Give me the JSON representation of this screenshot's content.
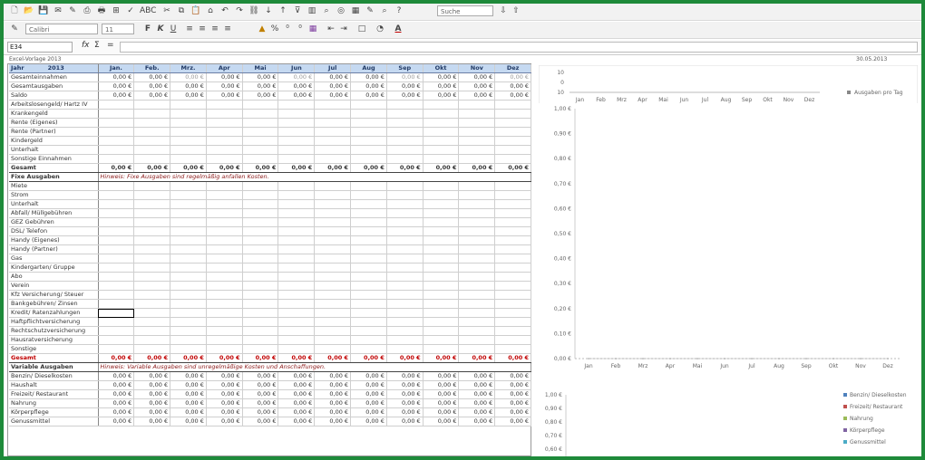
{
  "toolbar": {
    "search_placeholder": "Suche",
    "font_name": "Calibri",
    "font_size": "11",
    "bold_label": "F",
    "italic_label": "K",
    "underline_label": "U"
  },
  "formula_bar": {
    "cell_ref": "E34",
    "fx": "fx",
    "sum": "Σ",
    "eq": "="
  },
  "sheet": {
    "left_caption": "Excel-Vorlage 2013",
    "right_caption": "30.05.2013",
    "year_label": "Jahr",
    "year_value": "2013",
    "months": [
      "Jan.",
      "Feb.",
      "Mrz.",
      "Apr",
      "Mai",
      "Jun",
      "Jul",
      "Aug",
      "Sep",
      "Okt",
      "Nov",
      "Dez"
    ],
    "zero": "0,00 €",
    "summary_rows": [
      "Gesamteinnahmen",
      "Gesamtausgaben",
      "Saldo"
    ],
    "income_rows": [
      "Arbeitslosengeld/ Hartz IV",
      "Krankengeld",
      "Rente (Eigenes)",
      "Rente (Partner)",
      "Kindergeld",
      "Unterhalt",
      "Sonstige Einnahmen"
    ],
    "total_label": "Gesamt",
    "fixed_title": "Fixe Ausgaben",
    "fixed_hint": "Hinweis: Fixe Ausgaben sind regelmäßig anfallen Kosten.",
    "fixed_rows": [
      "Miete",
      "Strom",
      "Unterhalt",
      "Abfall/ Müllgebühren",
      "GEZ Gebühren",
      "DSL/ Telefon",
      "Handy (Eigenes)",
      "Handy (Partner)",
      "Gas",
      "Kindergarten/ Gruppe",
      "Abo",
      "Verein",
      "Kfz Versicherung/ Steuer",
      "Bankgebühren/ Zinsen",
      "Kredit/ Ratenzahlungen",
      "Haftpflichtversicherung",
      "Rechtschutzversicherung",
      "Hausratversicherung",
      "Sonstige"
    ],
    "var_title": "Variable Ausgaben",
    "var_hint": "Hinweis: Variable Ausgaben sind unregelmäßige Kosten und Anschaffungen.",
    "var_rows": [
      "Benzin/ Dieselkosten",
      "Haushalt",
      "Freizeit/ Restaurant",
      "Nahrung",
      "Körperpflege",
      "Genussmittel"
    ]
  },
  "chart_data": [
    {
      "type": "bar",
      "categories": [
        "Jan",
        "Feb",
        "Mrz",
        "Apr",
        "Mai",
        "Jun",
        "Jul",
        "Aug",
        "Sep",
        "Okt",
        "Nov",
        "Dez"
      ],
      "series": [
        {
          "name": "Ausgaben pro Tag",
          "values": [
            0,
            0,
            0,
            0,
            0,
            0,
            0,
            0,
            0,
            0,
            0,
            0
          ]
        }
      ],
      "y_ticks": [
        "10",
        "0",
        "10"
      ],
      "legend": "right"
    },
    {
      "type": "line",
      "categories": [
        "Jan",
        "Feb",
        "Mrz",
        "Apr",
        "Mai",
        "Jun",
        "Jul",
        "Aug",
        "Sep",
        "Okt",
        "Nov",
        "Dez"
      ],
      "series": [
        {
          "values": [
            0,
            0,
            0,
            0,
            0,
            0,
            0,
            0,
            0,
            0,
            0,
            0
          ]
        }
      ],
      "y_ticks": [
        "1,00 €",
        "0,90 €",
        "0,80 €",
        "0,70 €",
        "0,60 €",
        "0,50 €",
        "0,40 €",
        "0,30 €",
        "0,20 €",
        "0,10 €",
        "0,00 €"
      ],
      "ylim": [
        0,
        1
      ]
    },
    {
      "type": "bar",
      "y_ticks": [
        "1,00 €",
        "0,90 €",
        "0,80 €",
        "0,70 €",
        "0,60 €"
      ],
      "legend_entries": [
        "Benzin/ Dieselkosten",
        "Freizeit/ Restaurant",
        "Nahrung",
        "Körperpflege",
        "Genussmittel"
      ],
      "legend": "right"
    }
  ]
}
